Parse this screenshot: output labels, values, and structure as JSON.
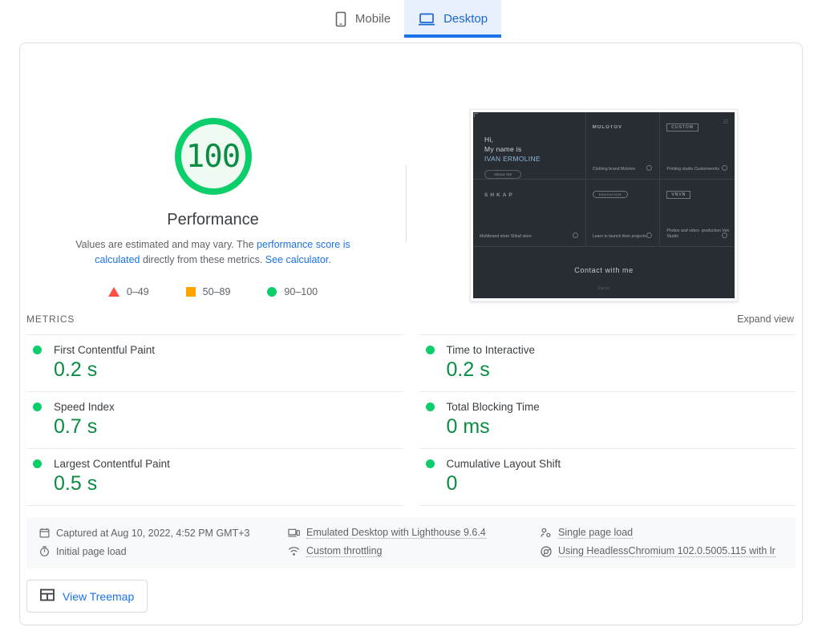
{
  "tabs": [
    {
      "id": "mobile",
      "label": "Mobile",
      "icon": "phone-icon",
      "active": false
    },
    {
      "id": "desktop",
      "label": "Desktop",
      "icon": "laptop-icon",
      "active": true
    }
  ],
  "score": {
    "value": "100",
    "title": "Performance",
    "description_pre": "Values are estimated and may vary. The ",
    "description_link1": "performance score is calculated",
    "description_mid": " directly from these metrics. ",
    "description_link2": "See calculator",
    "description_end": ".",
    "ring_color": "#0cce6b",
    "fill_color": "#effaf3",
    "value_color": "#0b8c43"
  },
  "legend": [
    {
      "shape": "triangle",
      "color": "#ff4e42",
      "range": "0–49"
    },
    {
      "shape": "square",
      "color": "#ffa400",
      "range": "50–89"
    },
    {
      "shape": "circle",
      "color": "#0cce6b",
      "range": "90–100"
    }
  ],
  "thumbnail": {
    "hero_line1": "Hi,",
    "hero_line2": "My name is",
    "hero_line3": "IVAN ERMOLINE",
    "hero_button": "About me",
    "cells": [
      {
        "logo": "MOLOTOV",
        "logo_style": "plain",
        "caption": "Clothing brand Molotov"
      },
      {
        "logo": "CUSTOM",
        "logo_style": "box",
        "caption": "Printing studio\nCustomworks"
      },
      {
        "logo": "SHKAP",
        "logo_style": "spaced",
        "caption": "Multibrand\nstore Shkaf store"
      },
      {
        "logo": "EDUCATION",
        "logo_style": "pill",
        "caption": "Learn to launch\ntheir projects"
      },
      {
        "logo": "VNVN",
        "logo_style": "box",
        "caption": "Photos and video-\nproduction\nVen Studio"
      }
    ],
    "footer_text": "Contact with me",
    "footer_small": "Davio"
  },
  "metrics_section": {
    "label": "METRICS",
    "expand_label": "Expand view",
    "left_column": [
      {
        "name": "First Contentful Paint",
        "value": "0.2 s",
        "status": "pass",
        "color": "#0cce6b"
      },
      {
        "name": "Speed Index",
        "value": "0.7 s",
        "status": "pass",
        "color": "#0cce6b"
      },
      {
        "name": "Largest Contentful Paint",
        "value": "0.5 s",
        "status": "pass",
        "color": "#0cce6b"
      }
    ],
    "right_column": [
      {
        "name": "Time to Interactive",
        "value": "0.2 s",
        "status": "pass",
        "color": "#0cce6b"
      },
      {
        "name": "Total Blocking Time",
        "value": "0 ms",
        "status": "pass",
        "color": "#0cce6b"
      },
      {
        "name": "Cumulative Layout Shift",
        "value": "0",
        "status": "pass",
        "color": "#0cce6b"
      }
    ]
  },
  "meta": {
    "captured": "Captured at Aug 10, 2022, 4:52 PM GMT+3",
    "captured_icon": "calendar-icon",
    "page_load": "Initial page load",
    "page_load_icon": "stopwatch-icon",
    "emulation": "Emulated Desktop with Lighthouse 9.6.4",
    "emulation_icon": "devices-icon",
    "throttling": "Custom throttling",
    "throttling_icon": "network-icon",
    "single_load": "Single page load",
    "single_load_icon": "user-flow-icon",
    "user_agent": "Using HeadlessChromium 102.0.5005.115 with lr",
    "user_agent_icon": "chrome-icon"
  },
  "treemap": {
    "label": "View Treemap",
    "icon": "treemap-icon"
  }
}
